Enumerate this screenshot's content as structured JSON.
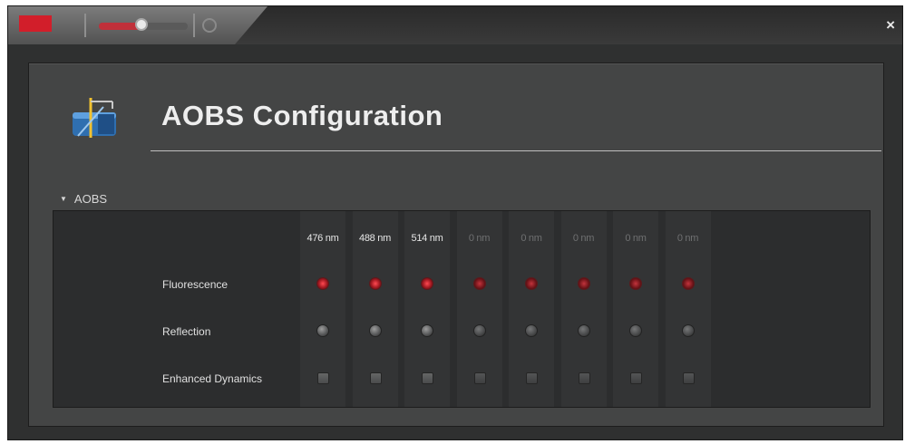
{
  "window": {
    "close_label": "×",
    "logo_icon": "leica-logo-icon",
    "help_icon": "help-icon",
    "slider_level": 0.46
  },
  "header": {
    "title": "AOBS Configuration",
    "icon": "aobs-filter-icon"
  },
  "section": {
    "label": "AOBS",
    "expanded": true
  },
  "channels": {
    "wavelengths": [
      "476 nm",
      "488 nm",
      "514 nm",
      "0 nm",
      "0 nm",
      "0 nm",
      "0 nm",
      "0 nm"
    ],
    "active": [
      true,
      true,
      true,
      false,
      false,
      false,
      false,
      false
    ]
  },
  "rows": {
    "fluorescence": "Fluorescence",
    "reflection": "Reflection",
    "enhanced": "Enhanced Dynamics"
  },
  "colors": {
    "accent_red": "#c0303a",
    "panel_bg": "#444545",
    "grid_bg": "#2c2d2e"
  }
}
